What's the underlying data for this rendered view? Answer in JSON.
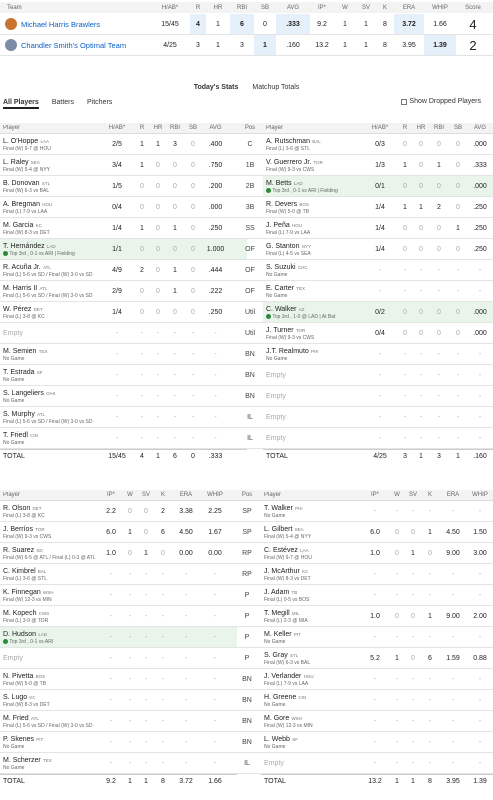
{
  "matchup": {
    "headers": {
      "team": "Team",
      "hab": "H/AB*",
      "r": "R",
      "hr": "HR",
      "rbi": "RBI",
      "sb": "SB",
      "avg": "AVG",
      "ip": "IP*",
      "w": "W",
      "sv": "SV",
      "k": "K",
      "era": "ERA",
      "whip": "WHIP",
      "score": "Score"
    },
    "teams": [
      {
        "name": "Michael Harris Brawlers",
        "hab": "15/45",
        "r": "4",
        "hr": "1",
        "rbi": "6",
        "sb": "0",
        "avg": ".333",
        "ip": "9.2",
        "w": "1",
        "sv": "1",
        "k": "8",
        "era": "3.72",
        "whip": "1.66",
        "score": "4",
        "logo_color": "#c8742e"
      },
      {
        "name": "Chandler Smith's Optimal Team",
        "hab": "4/25",
        "r": "3",
        "hr": "1",
        "rbi": "3",
        "sb": "1",
        "avg": ".160",
        "ip": "13.2",
        "w": "1",
        "sv": "1",
        "k": "8",
        "era": "3.95",
        "whip": "1.39",
        "score": "2",
        "logo_color": "#7a8ca8"
      }
    ]
  },
  "tabs": {
    "today": "Today's Stats",
    "totals": "Matchup Totals"
  },
  "subtabs": {
    "all": "All Players",
    "batters": "Batters",
    "pitchers": "Pitchers"
  },
  "show_dropped": "Show Dropped Players",
  "batting": {
    "headers": {
      "player": "Player",
      "hab": "H/AB*",
      "r": "R",
      "hr": "HR",
      "rbi": "RBI",
      "sb": "SB",
      "avg": "AVG",
      "pos": "Pos"
    },
    "rows": [
      {
        "pos": "C",
        "l": {
          "name": "L. O'Hoppe",
          "team": "LAA",
          "status": "Final (W) 9-7 @ HOU",
          "s": [
            "2/5",
            "1",
            "1",
            "3",
            "0",
            ".400"
          ]
        },
        "r": {
          "name": "A. Rutschman",
          "team": "BAL",
          "status": "Final (L) 3-6 @ STL",
          "s": [
            "0/3",
            "0",
            "0",
            "0",
            "0",
            ".000"
          ]
        }
      },
      {
        "pos": "1B",
        "l": {
          "name": "L. Raley",
          "team": "SEA",
          "status": "Final (W) 5-4 @ NYY",
          "s": [
            "3/4",
            "1",
            "0",
            "0",
            "0",
            ".750"
          ]
        },
        "r": {
          "name": "V. Guerrero Jr.",
          "team": "TOR",
          "status": "Final (W) 9-3 vs CWS",
          "s": [
            "1/3",
            "1",
            "0",
            "1",
            "0",
            ".333"
          ]
        }
      },
      {
        "pos": "2B",
        "l": {
          "name": "B. Donovan",
          "team": "STL",
          "status": "Final (W) 6-3 vs BAL",
          "s": [
            "1/5",
            "0",
            "0",
            "0",
            "0",
            ".200"
          ]
        },
        "r": {
          "name": "M. Betts",
          "team": "LAD",
          "status": "Top 3rd , 0-1 vs ARI | Fielding",
          "live": true,
          "s": [
            "0/1",
            "0",
            "0",
            "0",
            "0",
            ".000"
          ]
        }
      },
      {
        "pos": "3B",
        "l": {
          "name": "A. Bregman",
          "team": "HOU",
          "status": "Final (L) 7-9 vs LAA",
          "s": [
            "0/4",
            "0",
            "0",
            "0",
            "0",
            ".000"
          ]
        },
        "r": {
          "name": "R. Devers",
          "team": "BOS",
          "status": "Final (W) 5-0 @ TB",
          "s": [
            "1/4",
            "1",
            "1",
            "2",
            "0",
            ".250"
          ]
        }
      },
      {
        "pos": "SS",
        "l": {
          "name": "M. Garcia",
          "team": "KC",
          "status": "Final (W) 8-3 vs DET",
          "s": [
            "1/4",
            "1",
            "0",
            "1",
            "0",
            ".250"
          ]
        },
        "r": {
          "name": "J. Peña",
          "team": "HOU",
          "status": "Final (L) 7-9 vs LAA",
          "s": [
            "1/4",
            "0",
            "0",
            "0",
            "1",
            ".250"
          ]
        }
      },
      {
        "pos": "OF",
        "l": {
          "name": "T. Hernández",
          "team": "LAD",
          "status": "Top 3rd , 0-1 vs ARI | Fielding",
          "live": true,
          "s": [
            "1/1",
            "0",
            "0",
            "0",
            "0",
            "1.000"
          ]
        },
        "r": {
          "name": "G. Stanton",
          "team": "NYY",
          "status": "Final (L) 4-5 vs SEA",
          "s": [
            "1/4",
            "0",
            "0",
            "0",
            "0",
            ".250"
          ]
        }
      },
      {
        "pos": "OF",
        "l": {
          "name": "R. Acuña Jr.",
          "team": "ATL",
          "status": "Final (L) 5-6 vs SD / Final (W) 3-0 vs SD",
          "s": [
            "4/9",
            "2",
            "0",
            "1",
            "0",
            ".444"
          ]
        },
        "r": {
          "name": "S. Suzuki",
          "team": "CHC",
          "status": "No Game",
          "s": [
            "-",
            "-",
            "-",
            "-",
            "-",
            "-"
          ]
        }
      },
      {
        "pos": "OF",
        "l": {
          "name": "M. Harris II",
          "team": "ATL",
          "status": "Final (L) 5-6 vs SD / Final (W) 3-0 vs SD",
          "s": [
            "2/9",
            "0",
            "0",
            "1",
            "0",
            ".222"
          ]
        },
        "r": {
          "name": "E. Carter",
          "team": "TEX",
          "status": "No Game",
          "s": [
            "-",
            "-",
            "-",
            "-",
            "-",
            "-"
          ]
        }
      },
      {
        "pos": "Util",
        "l": {
          "name": "W. Pérez",
          "team": "DET",
          "status": "Final (L) 3-8 @ KC",
          "s": [
            "1/4",
            "0",
            "0",
            "0",
            "0",
            ".250"
          ]
        },
        "r": {
          "name": "C. Walker",
          "team": "AZ",
          "status": "Top 3rd , 1-0 @ LAD | At Bat",
          "live": true,
          "s": [
            "0/2",
            "0",
            "0",
            "0",
            "0",
            ".000"
          ]
        }
      },
      {
        "pos": "Util",
        "l": {
          "empty": "Empty",
          "s": [
            "-",
            "-",
            "-",
            "-",
            "-",
            "-"
          ]
        },
        "r": {
          "name": "J. Turner",
          "team": "TOR",
          "status": "Final (W) 9-3 vs CWS",
          "s": [
            "0/4",
            "0",
            "0",
            "0",
            "0",
            ".000"
          ]
        }
      },
      {
        "pos": "BN",
        "l": {
          "name": "M. Semien",
          "team": "TEX",
          "status": "No Game",
          "s": [
            "-",
            "-",
            "-",
            "-",
            "-",
            "-"
          ]
        },
        "r": {
          "name": "J.T. Realmuto",
          "team": "PHI",
          "status": "No Game",
          "s": [
            "-",
            "-",
            "-",
            "-",
            "-",
            "-"
          ]
        }
      },
      {
        "pos": "BN",
        "l": {
          "name": "T. Estrada",
          "team": "SF",
          "status": "No Game",
          "s": [
            "-",
            "-",
            "-",
            "-",
            "-",
            "-"
          ]
        },
        "r": {
          "empty": "Empty",
          "s": [
            "-",
            "-",
            "-",
            "-",
            "-",
            "-"
          ]
        }
      },
      {
        "pos": "BN",
        "l": {
          "name": "S. Langeliers",
          "team": "OAK",
          "status": "No Game",
          "s": [
            "-",
            "-",
            "-",
            "-",
            "-",
            "-"
          ]
        },
        "r": {
          "empty": "Empty",
          "s": [
            "-",
            "-",
            "-",
            "-",
            "-",
            "-"
          ]
        }
      },
      {
        "pos": "IL",
        "l": {
          "name": "S. Murphy",
          "team": "ATL",
          "status": "Final (L) 5-6 vs SD / Final (W) 3-0 vs SD",
          "s": [
            "-",
            "-",
            "-",
            "-",
            "-",
            "-"
          ]
        },
        "r": {
          "empty": "Empty",
          "s": [
            "-",
            "-",
            "-",
            "-",
            "-",
            "-"
          ]
        }
      },
      {
        "pos": "IL",
        "l": {
          "name": "T. Friedl",
          "team": "CIN",
          "status": "No Game",
          "s": [
            "-",
            "-",
            "-",
            "-",
            "-",
            "-"
          ]
        },
        "r": {
          "empty": "Empty",
          "s": [
            "-",
            "-",
            "-",
            "-",
            "-",
            "-"
          ]
        }
      }
    ],
    "total": {
      "label": "TOTAL",
      "l": [
        "15/45",
        "4",
        "1",
        "6",
        "0",
        ".333"
      ],
      "r": [
        "4/25",
        "3",
        "1",
        "3",
        "1",
        ".160"
      ]
    }
  },
  "pitching": {
    "headers": {
      "player": "Player",
      "ip": "IP*",
      "w": "W",
      "sv": "SV",
      "k": "K",
      "era": "ERA",
      "whip": "WHIP",
      "pos": "Pos"
    },
    "rows": [
      {
        "pos": "SP",
        "l": {
          "name": "R. Olson",
          "team": "DET",
          "status": "Final (L) 3-8 @ KC",
          "s": [
            "2.2",
            "0",
            "0",
            "2",
            "3.38",
            "2.25"
          ]
        },
        "r": {
          "name": "T. Walker",
          "team": "PHI",
          "status": "No Game",
          "s": [
            "-",
            "-",
            "-",
            "-",
            "-",
            "-"
          ]
        }
      },
      {
        "pos": "SP",
        "l": {
          "name": "J. Berríos",
          "team": "TOR",
          "status": "Final (W) 9-3 vs CWS",
          "s": [
            "6.0",
            "1",
            "0",
            "6",
            "4.50",
            "1.67"
          ]
        },
        "r": {
          "name": "L. Gilbert",
          "team": "SEA",
          "status": "Final (W) 5-4 @ NYY",
          "s": [
            "6.0",
            "0",
            "0",
            "1",
            "4.50",
            "1.50"
          ]
        }
      },
      {
        "pos": "RP",
        "l": {
          "name": "R. Suarez",
          "team": "SD",
          "status": "Final (W) 6-5 @ ATL / Final (L) 0-3 @ ATL",
          "s": [
            "1.0",
            "0",
            "1",
            "0",
            "0.00",
            "0.00"
          ]
        },
        "r": {
          "name": "C. Estévez",
          "team": "LAA",
          "status": "Final (W) 9-7 @ HOU",
          "s": [
            "1.0",
            "0",
            "1",
            "0",
            "9.00",
            "3.00"
          ]
        }
      },
      {
        "pos": "RP",
        "l": {
          "name": "C. Kimbrel",
          "team": "BAL",
          "status": "Final (L) 3-6 @ STL",
          "s": [
            "-",
            "-",
            "-",
            "-",
            "-",
            "-"
          ]
        },
        "r": {
          "name": "J. McArthur",
          "team": "KC",
          "status": "Final (W) 8-3 vs DET",
          "s": [
            "-",
            "-",
            "-",
            "-",
            "-",
            "-"
          ]
        }
      },
      {
        "pos": "P",
        "l": {
          "name": "K. Finnegan",
          "team": "WSH",
          "status": "Final (W) 12-3 vs MIN",
          "s": [
            "-",
            "-",
            "-",
            "-",
            "-",
            "-"
          ]
        },
        "r": {
          "name": "J. Adam",
          "team": "TB",
          "status": "Final (L) 0-5 vs BOS",
          "s": [
            "-",
            "-",
            "-",
            "-",
            "-",
            "-"
          ]
        }
      },
      {
        "pos": "P",
        "l": {
          "name": "M. Kopech",
          "team": "CWS",
          "status": "Final (L) 3-9 @ TOR",
          "s": [
            "-",
            "-",
            "-",
            "-",
            "-",
            "-"
          ]
        },
        "r": {
          "name": "T. Megill",
          "team": "MIL",
          "status": "Final (L) 2-3 @ MIA",
          "s": [
            "1.0",
            "0",
            "0",
            "1",
            "9.00",
            "2.00"
          ]
        }
      },
      {
        "pos": "P",
        "l": {
          "name": "D. Hudson",
          "team": "LAD",
          "status": "Top 3rd , 0-1 vs ARI",
          "live": true,
          "s": [
            "-",
            "-",
            "-",
            "-",
            "-",
            "-"
          ]
        },
        "r": {
          "name": "M. Keller",
          "team": "PIT",
          "status": "No Game",
          "s": [
            "-",
            "-",
            "-",
            "-",
            "-",
            "-"
          ]
        }
      },
      {
        "pos": "P",
        "l": {
          "empty": "Empty",
          "s": [
            "-",
            "-",
            "-",
            "-",
            "-",
            "-"
          ]
        },
        "r": {
          "name": "S. Gray",
          "team": "STL",
          "status": "Final (W) 6-3 vs BAL",
          "s": [
            "5.2",
            "1",
            "0",
            "6",
            "1.59",
            "0.88"
          ]
        }
      },
      {
        "pos": "BN",
        "l": {
          "name": "N. Pivetta",
          "team": "BOS",
          "status": "Final (W) 5-0 @ TB",
          "s": [
            "-",
            "-",
            "-",
            "-",
            "-",
            "-"
          ]
        },
        "r": {
          "name": "J. Verlander",
          "team": "HOU",
          "status": "Final (L) 7-9 vs LAA",
          "s": [
            "-",
            "-",
            "-",
            "-",
            "-",
            "-"
          ]
        }
      },
      {
        "pos": "BN",
        "l": {
          "name": "S. Lugo",
          "team": "KC",
          "status": "Final (W) 8-3 vs DET",
          "s": [
            "-",
            "-",
            "-",
            "-",
            "-",
            "-"
          ]
        },
        "r": {
          "name": "H. Greene",
          "team": "CIN",
          "status": "No Game",
          "s": [
            "-",
            "-",
            "-",
            "-",
            "-",
            "-"
          ]
        }
      },
      {
        "pos": "BN",
        "l": {
          "name": "M. Fried",
          "team": "ATL",
          "status": "Final (L) 5-6 vs SD / Final (W) 3-0 vs SD",
          "s": [
            "-",
            "-",
            "-",
            "-",
            "-",
            "-"
          ]
        },
        "r": {
          "name": "M. Gore",
          "team": "WSH",
          "status": "Final (W) 12-3 vs MIN",
          "s": [
            "-",
            "-",
            "-",
            "-",
            "-",
            "-"
          ]
        }
      },
      {
        "pos": "BN",
        "l": {
          "name": "P. Skenes",
          "team": "PIT",
          "status": "No Game",
          "s": [
            "-",
            "-",
            "-",
            "-",
            "-",
            "-"
          ]
        },
        "r": {
          "name": "L. Webb",
          "team": "SF",
          "status": "No Game",
          "s": [
            "-",
            "-",
            "-",
            "-",
            "-",
            "-"
          ]
        }
      },
      {
        "pos": "IL",
        "l": {
          "name": "M. Scherzer",
          "team": "TEX",
          "status": "No Game",
          "s": [
            "-",
            "-",
            "-",
            "-",
            "-",
            "-"
          ]
        },
        "r": {
          "empty": "Empty",
          "s": [
            "-",
            "-",
            "-",
            "-",
            "-",
            "-"
          ]
        }
      }
    ],
    "total": {
      "label": "TOTAL",
      "l": [
        "9.2",
        "1",
        "1",
        "8",
        "3.72",
        "1.66"
      ],
      "r": [
        "13.2",
        "1",
        "1",
        "8",
        "3.95",
        "1.39"
      ]
    }
  }
}
